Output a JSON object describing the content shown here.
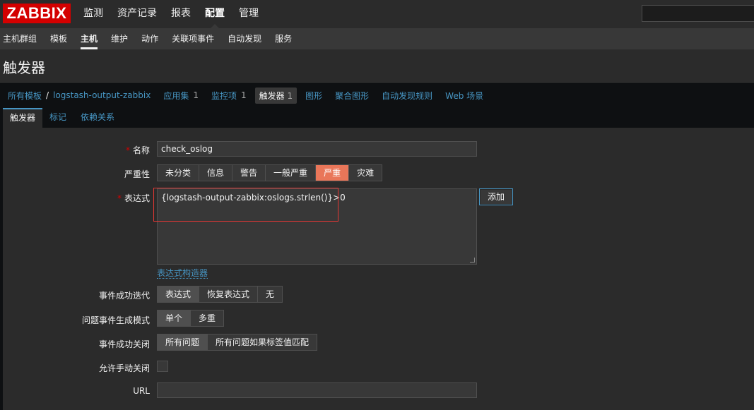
{
  "logo": "ZABBIX",
  "main_menu": [
    "监测",
    "资产记录",
    "报表",
    "配置",
    "管理"
  ],
  "main_menu_active": "配置",
  "sub_menu": [
    "主机群组",
    "模板",
    "主机",
    "维护",
    "动作",
    "关联项事件",
    "自动发现",
    "服务"
  ],
  "sub_menu_active": "主机",
  "page_title": "触发器",
  "breadcrumb": {
    "all_templates": "所有模板",
    "separator": "/",
    "host": "logstash-output-zabbix",
    "apps": "应用集",
    "apps_count": "1",
    "items": "监控项",
    "items_count": "1",
    "triggers": "触发器",
    "triggers_count": "1",
    "graphs": "图形",
    "screens": "聚合图形",
    "discovery": "自动发现规则",
    "web": "Web 场景"
  },
  "tabs": [
    "触发器",
    "标记",
    "依赖关系"
  ],
  "form": {
    "name_label": "名称",
    "name_value": "check_oslog",
    "severity_label": "严重性",
    "severity_options": [
      "未分类",
      "信息",
      "警告",
      "一般严重",
      "严重",
      "灾难"
    ],
    "severity_selected": "严重",
    "expression_label": "表达式",
    "expression_value": "{logstash-output-zabbix:oslogs.strlen()}>0",
    "add_button": "添加",
    "expression_builder_link": "表达式构造器",
    "ok_event_gen_label": "事件成功迭代",
    "ok_event_gen_options": [
      "表达式",
      "恢复表达式",
      "无"
    ],
    "problem_mode_label": "问题事件生成模式",
    "problem_mode_options": [
      "单个",
      "多重"
    ],
    "ok_close_label": "事件成功关闭",
    "ok_close_options": [
      "所有问题",
      "所有问题如果标签值匹配"
    ],
    "manual_close_label": "允许手动关闭",
    "url_label": "URL"
  },
  "colors": {
    "accent": "#4796c4",
    "severity_high": "#e97659",
    "brand": "#d40000"
  }
}
